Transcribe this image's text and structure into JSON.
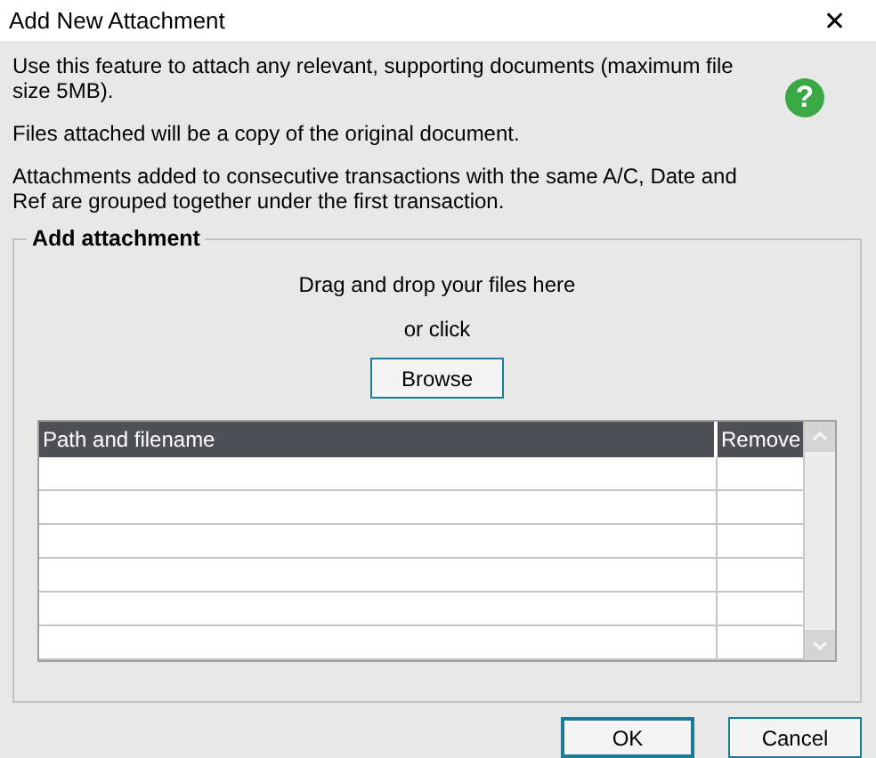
{
  "window": {
    "title": "Add New Attachment",
    "close": "✕"
  },
  "intro": [
    "Use this feature to attach any relevant, supporting documents (maximum file size 5MB).",
    "Files attached will be a copy of the original document.",
    "Attachments added to consecutive transactions with the same A/C, Date and Ref are grouped together under the first transaction."
  ],
  "help": "?",
  "group": {
    "title": "Add attachment",
    "drop_text": "Drag and drop your files here",
    "or_text": "or click",
    "browse": "Browse",
    "table": {
      "columns": [
        "Path and filename",
        "Remove"
      ]
    }
  },
  "buttons": [
    {
      "label": "OK",
      "default": true
    },
    {
      "label": "Cancel",
      "default": false
    }
  ]
}
